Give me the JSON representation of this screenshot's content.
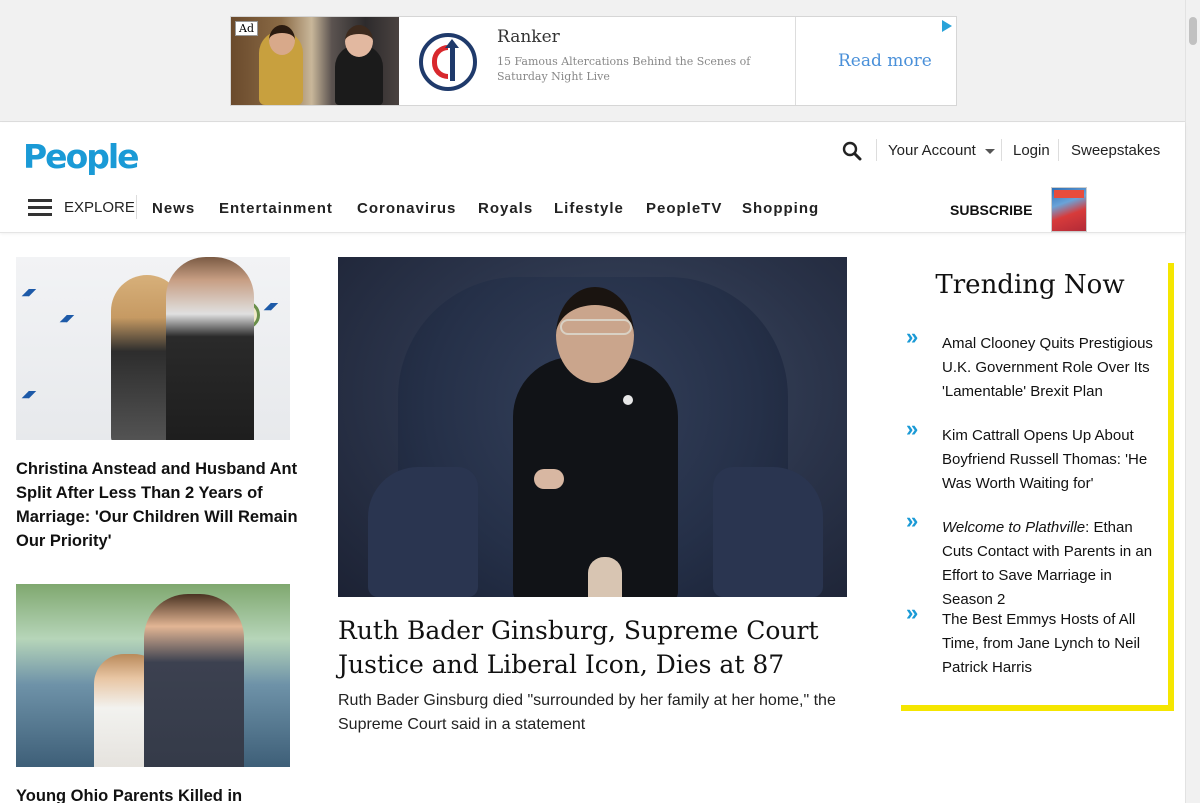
{
  "ad": {
    "badge": "Ad",
    "advertiser": "Ranker",
    "description": "15 Famous Altercations Behind the Scenes of Saturday Night Live",
    "cta": "Read more"
  },
  "header": {
    "logo": "People",
    "account_label": "Your Account",
    "login_label": "Login",
    "sweepstakes_label": "Sweepstakes",
    "explore_label": "EXPLORE",
    "nav_items": [
      "News",
      "Entertainment",
      "Coronavirus",
      "Royals",
      "Lifestyle",
      "PeopleTV",
      "Shopping"
    ],
    "subscribe_label": "SUBSCRIBE"
  },
  "left_stories": [
    {
      "title": "Christina Anstead and Husband Ant Split After Less Than 2 Years of Marriage: 'Our Children Will Remain Our Priority'"
    },
    {
      "title": "Young Ohio Parents Killed in"
    }
  ],
  "main_story": {
    "title": "Ruth Bader Ginsburg, Supreme Court Justice and Liberal Icon, Dies at 87",
    "description": "Ruth Bader Ginsburg died \"surrounded by her family at her home,\" the Supreme Court said in a statement"
  },
  "trending": {
    "title": "Trending Now",
    "items": [
      {
        "text": "Amal Clooney Quits Prestigious U.K. Government Role Over Its 'Lamentable' Brexit Plan"
      },
      {
        "text": "Kim Cattrall Opens Up About Boyfriend Russell Thomas: 'He Was Worth Waiting for'"
      },
      {
        "italic": "Welcome to Plathville",
        "text": ": Ethan Cuts Contact with Parents in an Effort to Save Marriage in Season 2"
      },
      {
        "text": "The Best Emmys Hosts of All Time, from Jane Lynch to Neil Patrick Harris"
      }
    ],
    "arrow_glyph": "»"
  },
  "colors": {
    "brand": "#1a9ad6",
    "trending_accent": "#f5e600",
    "ad_cta": "#4a90d9"
  }
}
